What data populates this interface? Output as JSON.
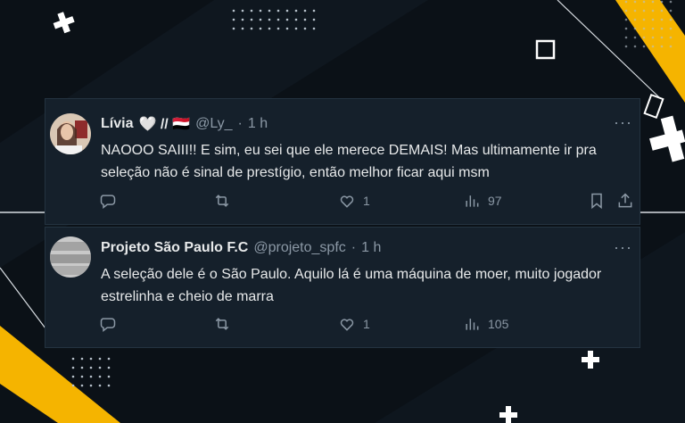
{
  "colors": {
    "background": "#0b1117",
    "card": "#15202b",
    "accent_yellow": "#f5b400",
    "text": "#e7e9ea",
    "muted": "#8b98a5"
  },
  "tweets": [
    {
      "name": "Lívia",
      "emoji": "🤍 // 🇾🇪",
      "handle": "@Ly_",
      "time": "1 h",
      "text": "NAOOO SAIII!! E sim, eu sei que ele merece DEMAIS! Mas ultimamente ir pra seleção não é sinal de prestígio, então melhor ficar aqui msm",
      "likes": "1",
      "views": "97",
      "more": "···"
    },
    {
      "name": "Projeto São Paulo F.C",
      "emoji": "",
      "handle": "@projeto_spfc",
      "time": "1 h",
      "text": "A seleção dele é o São Paulo. Aquilo lá é uma máquina de moer, muito jogador estrelinha e cheio de marra",
      "likes": "1",
      "views": "105",
      "more": "···"
    }
  ],
  "icons": [
    "reply-icon",
    "retweet-icon",
    "like-icon",
    "views-icon",
    "bookmark-icon",
    "share-icon"
  ]
}
